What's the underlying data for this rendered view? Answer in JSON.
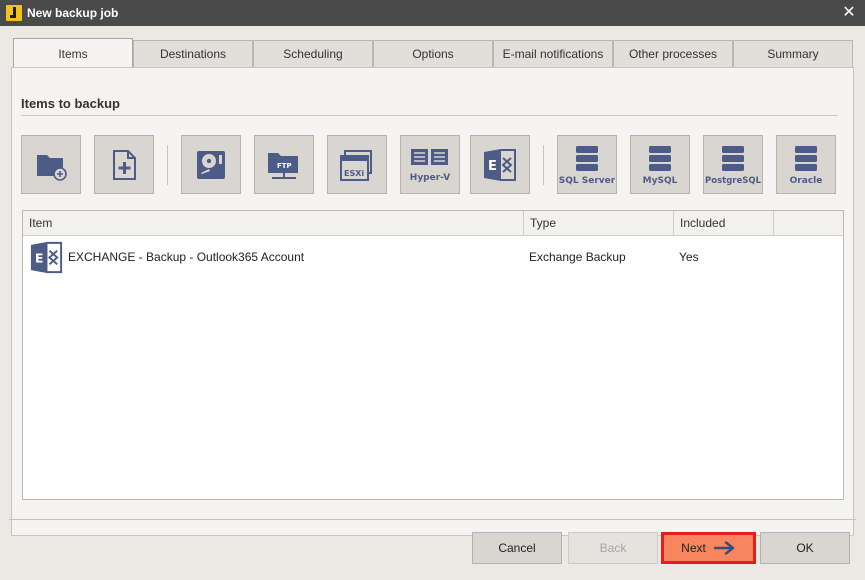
{
  "window": {
    "title": "New backup job",
    "close_label": "✕"
  },
  "tabs": [
    {
      "label": "Items",
      "active": true
    },
    {
      "label": "Destinations",
      "active": false
    },
    {
      "label": "Scheduling",
      "active": false
    },
    {
      "label": "Options",
      "active": false
    },
    {
      "label": "E-mail notifications",
      "active": false
    },
    {
      "label": "Other processes",
      "active": false
    },
    {
      "label": "Summary",
      "active": false
    }
  ],
  "section": {
    "title": "Items to backup"
  },
  "toolbar": {
    "buttons": [
      {
        "icon": "folder-add-icon",
        "label": ""
      },
      {
        "icon": "file-add-icon",
        "label": ""
      },
      {
        "icon": "disk-image-icon",
        "label": ""
      },
      {
        "icon": "ftp-icon",
        "label": "FTP"
      },
      {
        "icon": "esxi-icon",
        "label": "ESXi"
      },
      {
        "icon": "hyper-v-icon",
        "label": "Hyper-V"
      },
      {
        "icon": "exchange-icon",
        "label": ""
      },
      {
        "icon": "sql-server-icon",
        "label": "SQL Server"
      },
      {
        "icon": "mysql-icon",
        "label": "MySQL"
      },
      {
        "icon": "postgresql-icon",
        "label": "PostgreSQL"
      },
      {
        "icon": "oracle-icon",
        "label": "Oracle"
      }
    ]
  },
  "table": {
    "columns": [
      "Item",
      "Type",
      "Included"
    ],
    "rows": [
      {
        "icon": "exchange-icon",
        "item": "EXCHANGE - Backup - Outlook365 Account",
        "type": "Exchange Backup",
        "included": "Yes"
      }
    ]
  },
  "footer": {
    "cancel": "Cancel",
    "back": "Back",
    "next": "Next",
    "ok": "OK"
  },
  "colors": {
    "titlebar": "#4a4a4a",
    "icon_blue": "#4d5c86",
    "next_button": "#f7855e",
    "highlight_border": "#e81c1c",
    "accent_yellow": "#f2c21b"
  }
}
